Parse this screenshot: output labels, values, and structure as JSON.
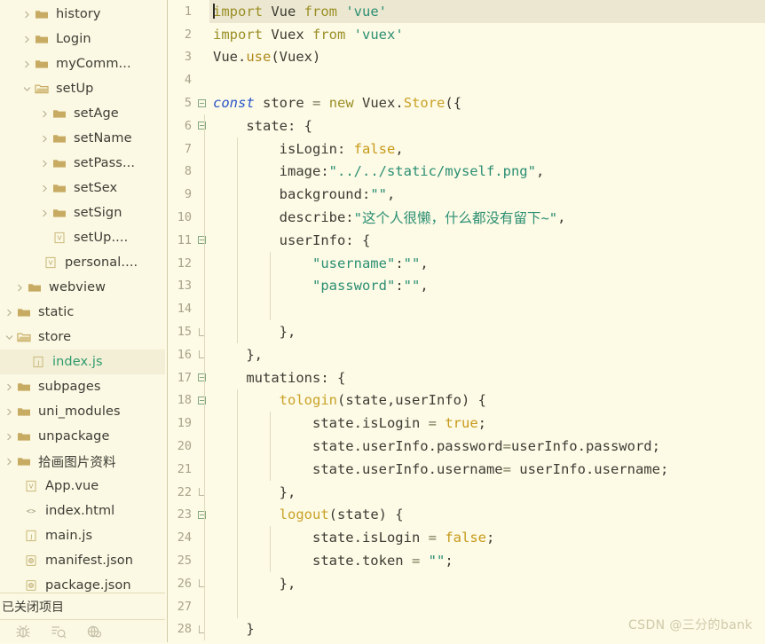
{
  "sidebar": {
    "tree": [
      {
        "label": "history",
        "type": "folder",
        "depth": 1,
        "arrow": "right"
      },
      {
        "label": "Login",
        "type": "folder",
        "depth": 1,
        "arrow": "right"
      },
      {
        "label": "myComm...",
        "type": "folder",
        "depth": 1,
        "arrow": "right"
      },
      {
        "label": "setUp",
        "type": "folder-open",
        "depth": 1,
        "arrow": "down"
      },
      {
        "label": "setAge",
        "type": "folder",
        "depth": 2,
        "arrow": "right"
      },
      {
        "label": "setName",
        "type": "folder",
        "depth": 2,
        "arrow": "right"
      },
      {
        "label": "setPass...",
        "type": "folder",
        "depth": 2,
        "arrow": "right"
      },
      {
        "label": "setSex",
        "type": "folder",
        "depth": 2,
        "arrow": "right"
      },
      {
        "label": "setSign",
        "type": "folder",
        "depth": 2,
        "arrow": "right"
      },
      {
        "label": "setUp....",
        "type": "vue",
        "depth": 2,
        "arrow": "none"
      },
      {
        "label": "personal....",
        "type": "vue",
        "depth": 1.5,
        "arrow": "none"
      },
      {
        "label": "webview",
        "type": "folder",
        "depth": 0.6,
        "arrow": "right"
      },
      {
        "label": "static",
        "type": "folder",
        "depth": 0,
        "arrow": "right"
      },
      {
        "label": "store",
        "type": "folder-open",
        "depth": 0,
        "arrow": "down"
      },
      {
        "label": "index.js",
        "type": "js",
        "depth": 0.8,
        "arrow": "none",
        "selected": true
      },
      {
        "label": "subpages",
        "type": "folder",
        "depth": 0,
        "arrow": "right"
      },
      {
        "label": "uni_modules",
        "type": "folder",
        "depth": 0,
        "arrow": "right"
      },
      {
        "label": "unpackage",
        "type": "folder",
        "depth": 0,
        "arrow": "right"
      },
      {
        "label": "拾画图片资料",
        "type": "folder",
        "depth": 0,
        "arrow": "right"
      },
      {
        "label": "App.vue",
        "type": "vue",
        "depth": 0.4,
        "arrow": "none"
      },
      {
        "label": "index.html",
        "type": "html",
        "depth": 0.4,
        "arrow": "none"
      },
      {
        "label": "main.js",
        "type": "js",
        "depth": 0.4,
        "arrow": "none"
      },
      {
        "label": "manifest.json",
        "type": "json",
        "depth": 0.4,
        "arrow": "none"
      },
      {
        "label": "package.json",
        "type": "json",
        "depth": 0.4,
        "arrow": "none"
      }
    ],
    "closed_projects_label": "已关闭项目",
    "status_icons": [
      "bug-icon",
      "log-search-icon",
      "browser-icon"
    ]
  },
  "editor": {
    "current_line": 1,
    "lines": [
      {
        "n": "1",
        "fold": "none",
        "indent": 0,
        "current": true,
        "tokens": [
          {
            "t": "caret",
            "v": ""
          },
          {
            "t": "kw",
            "v": "import"
          },
          {
            "t": "plain",
            "v": " Vue "
          },
          {
            "t": "kw",
            "v": "from"
          },
          {
            "t": "plain",
            "v": " "
          },
          {
            "t": "str",
            "v": "'vue'"
          }
        ]
      },
      {
        "n": "2",
        "fold": "none",
        "indent": 0,
        "tokens": [
          {
            "t": "kw",
            "v": "import"
          },
          {
            "t": "plain",
            "v": " Vuex "
          },
          {
            "t": "kw",
            "v": "from"
          },
          {
            "t": "plain",
            "v": " "
          },
          {
            "t": "str",
            "v": "'vuex'"
          }
        ]
      },
      {
        "n": "3",
        "fold": "none",
        "indent": 0,
        "tokens": [
          {
            "t": "plain",
            "v": "Vue."
          },
          {
            "t": "use",
            "v": "use"
          },
          {
            "t": "plain",
            "v": "(Vuex)"
          }
        ]
      },
      {
        "n": "4",
        "fold": "none",
        "indent": 0,
        "tokens": []
      },
      {
        "n": "5",
        "fold": "start",
        "indent": 0,
        "tokens": [
          {
            "t": "kw2",
            "v": "const"
          },
          {
            "t": "plain",
            "v": " store "
          },
          {
            "t": "op",
            "v": "="
          },
          {
            "t": "plain",
            "v": " "
          },
          {
            "t": "new",
            "v": "new"
          },
          {
            "t": "plain",
            "v": " Vuex."
          },
          {
            "t": "fn2",
            "v": "Store"
          },
          {
            "t": "plain",
            "v": "({"
          }
        ]
      },
      {
        "n": "6",
        "fold": "start",
        "indent": 1,
        "tokens": [
          {
            "t": "plain",
            "v": "    state: {"
          }
        ]
      },
      {
        "n": "7",
        "fold": "none",
        "indent": 2,
        "tokens": [
          {
            "t": "plain",
            "v": "        isLogin: "
          },
          {
            "t": "num",
            "v": "false"
          },
          {
            "t": "plain",
            "v": ","
          }
        ]
      },
      {
        "n": "8",
        "fold": "none",
        "indent": 2,
        "tokens": [
          {
            "t": "plain",
            "v": "        image:"
          },
          {
            "t": "str",
            "v": "\"../../static/myself.png\""
          },
          {
            "t": "plain",
            "v": ","
          }
        ]
      },
      {
        "n": "9",
        "fold": "none",
        "indent": 2,
        "tokens": [
          {
            "t": "plain",
            "v": "        background:"
          },
          {
            "t": "str",
            "v": "\"\""
          },
          {
            "t": "plain",
            "v": ","
          }
        ]
      },
      {
        "n": "10",
        "fold": "none",
        "indent": 2,
        "tokens": [
          {
            "t": "plain",
            "v": "        describe:"
          },
          {
            "t": "str",
            "v": "\"这个人很懒，什么都没有留下~\""
          },
          {
            "t": "plain",
            "v": ","
          }
        ]
      },
      {
        "n": "11",
        "fold": "start",
        "indent": 2,
        "tokens": [
          {
            "t": "plain",
            "v": "        userInfo: {"
          }
        ]
      },
      {
        "n": "12",
        "fold": "none",
        "indent": 3,
        "tokens": [
          {
            "t": "plain",
            "v": "            "
          },
          {
            "t": "str",
            "v": "\"username\""
          },
          {
            "t": "plain",
            "v": ":"
          },
          {
            "t": "str",
            "v": "\"\""
          },
          {
            "t": "plain",
            "v": ","
          }
        ]
      },
      {
        "n": "13",
        "fold": "none",
        "indent": 3,
        "tokens": [
          {
            "t": "plain",
            "v": "            "
          },
          {
            "t": "str",
            "v": "\"password\""
          },
          {
            "t": "plain",
            "v": ":"
          },
          {
            "t": "str",
            "v": "\"\""
          },
          {
            "t": "plain",
            "v": ","
          }
        ]
      },
      {
        "n": "14",
        "fold": "none",
        "indent": 3,
        "tokens": []
      },
      {
        "n": "15",
        "fold": "end",
        "indent": 2,
        "tokens": [
          {
            "t": "plain",
            "v": "        },"
          }
        ]
      },
      {
        "n": "16",
        "fold": "end",
        "indent": 1,
        "tokens": [
          {
            "t": "plain",
            "v": "    },"
          }
        ]
      },
      {
        "n": "17",
        "fold": "start",
        "indent": 1,
        "tokens": [
          {
            "t": "plain",
            "v": "    mutations: {"
          }
        ]
      },
      {
        "n": "18",
        "fold": "start",
        "indent": 2,
        "tokens": [
          {
            "t": "plain",
            "v": "        "
          },
          {
            "t": "fn",
            "v": "tologin"
          },
          {
            "t": "plain",
            "v": "(state,userInfo) {"
          }
        ]
      },
      {
        "n": "19",
        "fold": "none",
        "indent": 3,
        "tokens": [
          {
            "t": "plain",
            "v": "            state.isLogin "
          },
          {
            "t": "op",
            "v": "="
          },
          {
            "t": "plain",
            "v": " "
          },
          {
            "t": "num",
            "v": "true"
          },
          {
            "t": "plain",
            "v": ";"
          }
        ]
      },
      {
        "n": "20",
        "fold": "none",
        "indent": 3,
        "tokens": [
          {
            "t": "plain",
            "v": "            state.userInfo.password"
          },
          {
            "t": "op",
            "v": "="
          },
          {
            "t": "plain",
            "v": "userInfo.password;"
          }
        ]
      },
      {
        "n": "21",
        "fold": "none",
        "indent": 3,
        "tokens": [
          {
            "t": "plain",
            "v": "            state.userInfo.username"
          },
          {
            "t": "op",
            "v": "="
          },
          {
            "t": "plain",
            "v": " userInfo.username;"
          }
        ]
      },
      {
        "n": "22",
        "fold": "end",
        "indent": 2,
        "tokens": [
          {
            "t": "plain",
            "v": "        },"
          }
        ]
      },
      {
        "n": "23",
        "fold": "start",
        "indent": 2,
        "tokens": [
          {
            "t": "plain",
            "v": "        "
          },
          {
            "t": "fn",
            "v": "logout"
          },
          {
            "t": "plain",
            "v": "(state) {"
          }
        ]
      },
      {
        "n": "24",
        "fold": "none",
        "indent": 3,
        "tokens": [
          {
            "t": "plain",
            "v": "            state.isLogin "
          },
          {
            "t": "op",
            "v": "="
          },
          {
            "t": "plain",
            "v": " "
          },
          {
            "t": "num",
            "v": "false"
          },
          {
            "t": "plain",
            "v": ";"
          }
        ]
      },
      {
        "n": "25",
        "fold": "none",
        "indent": 3,
        "tokens": [
          {
            "t": "plain",
            "v": "            state.token "
          },
          {
            "t": "op",
            "v": "="
          },
          {
            "t": "plain",
            "v": " "
          },
          {
            "t": "str",
            "v": "\"\""
          },
          {
            "t": "plain",
            "v": ";"
          }
        ]
      },
      {
        "n": "26",
        "fold": "end",
        "indent": 2,
        "tokens": [
          {
            "t": "plain",
            "v": "        },"
          }
        ]
      },
      {
        "n": "27",
        "fold": "none",
        "indent": 2,
        "tokens": []
      },
      {
        "n": "28",
        "fold": "end",
        "indent": 1,
        "tokens": [
          {
            "t": "plain",
            "v": "    }"
          }
        ]
      }
    ]
  },
  "watermark": "CSDN @三分的bank",
  "colors": {
    "editor_bg": "#fdfae6",
    "sidebar_bg": "#fbf8e3",
    "current_line": "#ece7d0",
    "string": "#2b8f72",
    "keyword": "#9a8f26",
    "function": "#c9a227",
    "selected_label": "#2f9b6e",
    "folder": "#c8ab63"
  }
}
